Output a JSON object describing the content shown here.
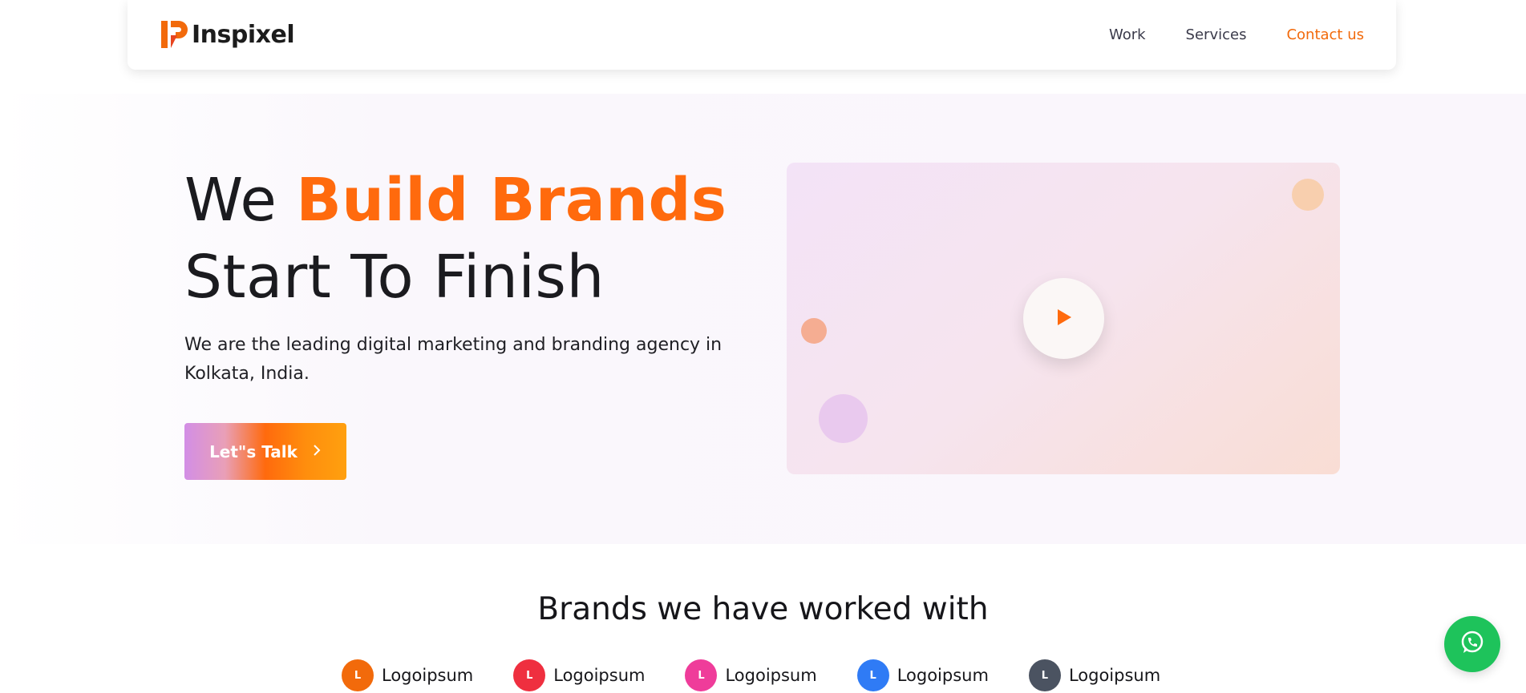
{
  "header": {
    "logo_text": "Inspixel",
    "nav": [
      {
        "label": "Work"
      },
      {
        "label": "Services"
      },
      {
        "label": "Contact us"
      }
    ]
  },
  "hero": {
    "title_part1": "We ",
    "title_accent": "Build Brands",
    "title_line2": "Start To Finish",
    "subtitle": "We are the leading digital marketing and branding agency in Kolkata, India.",
    "cta_label": "Let\"s Talk"
  },
  "brands": {
    "title": "Brands we have worked with",
    "items": [
      {
        "initial": "L",
        "name": "Logoipsum",
        "color": "#f26a0b"
      },
      {
        "initial": "L",
        "name": "Logoipsum",
        "color": "#ef2f3f"
      },
      {
        "initial": "L",
        "name": "Logoipsum",
        "color": "#ef3c9a"
      },
      {
        "initial": "L",
        "name": "Logoipsum",
        "color": "#2f7bf5"
      },
      {
        "initial": "L",
        "name": "Logoipsum",
        "color": "#4b5361"
      }
    ]
  },
  "colors": {
    "accent": "#ff6a0d",
    "whatsapp": "#1ec35b"
  },
  "icons": {
    "play": "play-icon",
    "whatsapp": "whatsapp-icon",
    "cta_chevron": "chevron-right-icon"
  }
}
